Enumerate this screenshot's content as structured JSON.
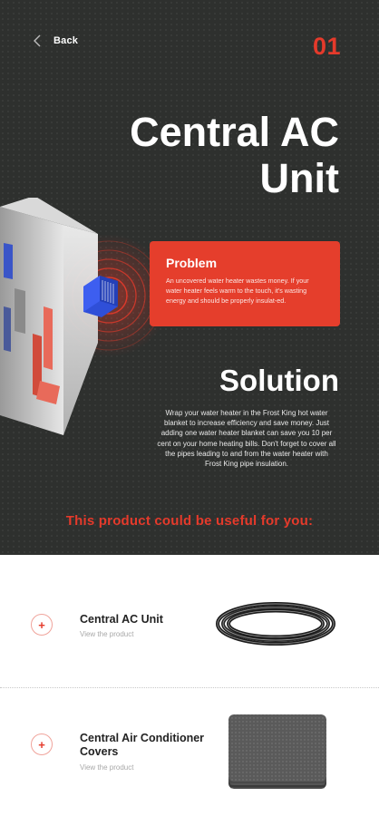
{
  "nav": {
    "back_label": "Back",
    "page_number": "01"
  },
  "hero": {
    "title": "Central AC Unit"
  },
  "problem": {
    "title": "Problem",
    "text": "An uncovered water heater wastes money. If your water heater feels warm to the touch, it's wasting energy and should be properly insulat-ed."
  },
  "solution": {
    "title": "Solution",
    "text": "Wrap your water heater in the Frost King hot water blanket to increase efficiency and save money. Just adding one water heater blanket can save you 10 per cent on your home heating bills. Don't forget to cover all the pipes leading to and from the water heater with Frost King pipe insulation."
  },
  "products": {
    "heading": "This product could be useful for you:",
    "items": [
      {
        "name": "Central AC Unit",
        "link_label": "View the product",
        "add_symbol": "+"
      },
      {
        "name": "Central Air Conditioner Covers",
        "link_label": "View the product",
        "add_symbol": "+"
      }
    ]
  },
  "colors": {
    "accent": "#e53a2b",
    "card": "#e53e2c",
    "hero_bg": "#2e302e",
    "text_dark": "#222222",
    "text_muted": "#a8a8a8"
  },
  "icons": [
    "chevron-left-icon",
    "plus-icon"
  ]
}
